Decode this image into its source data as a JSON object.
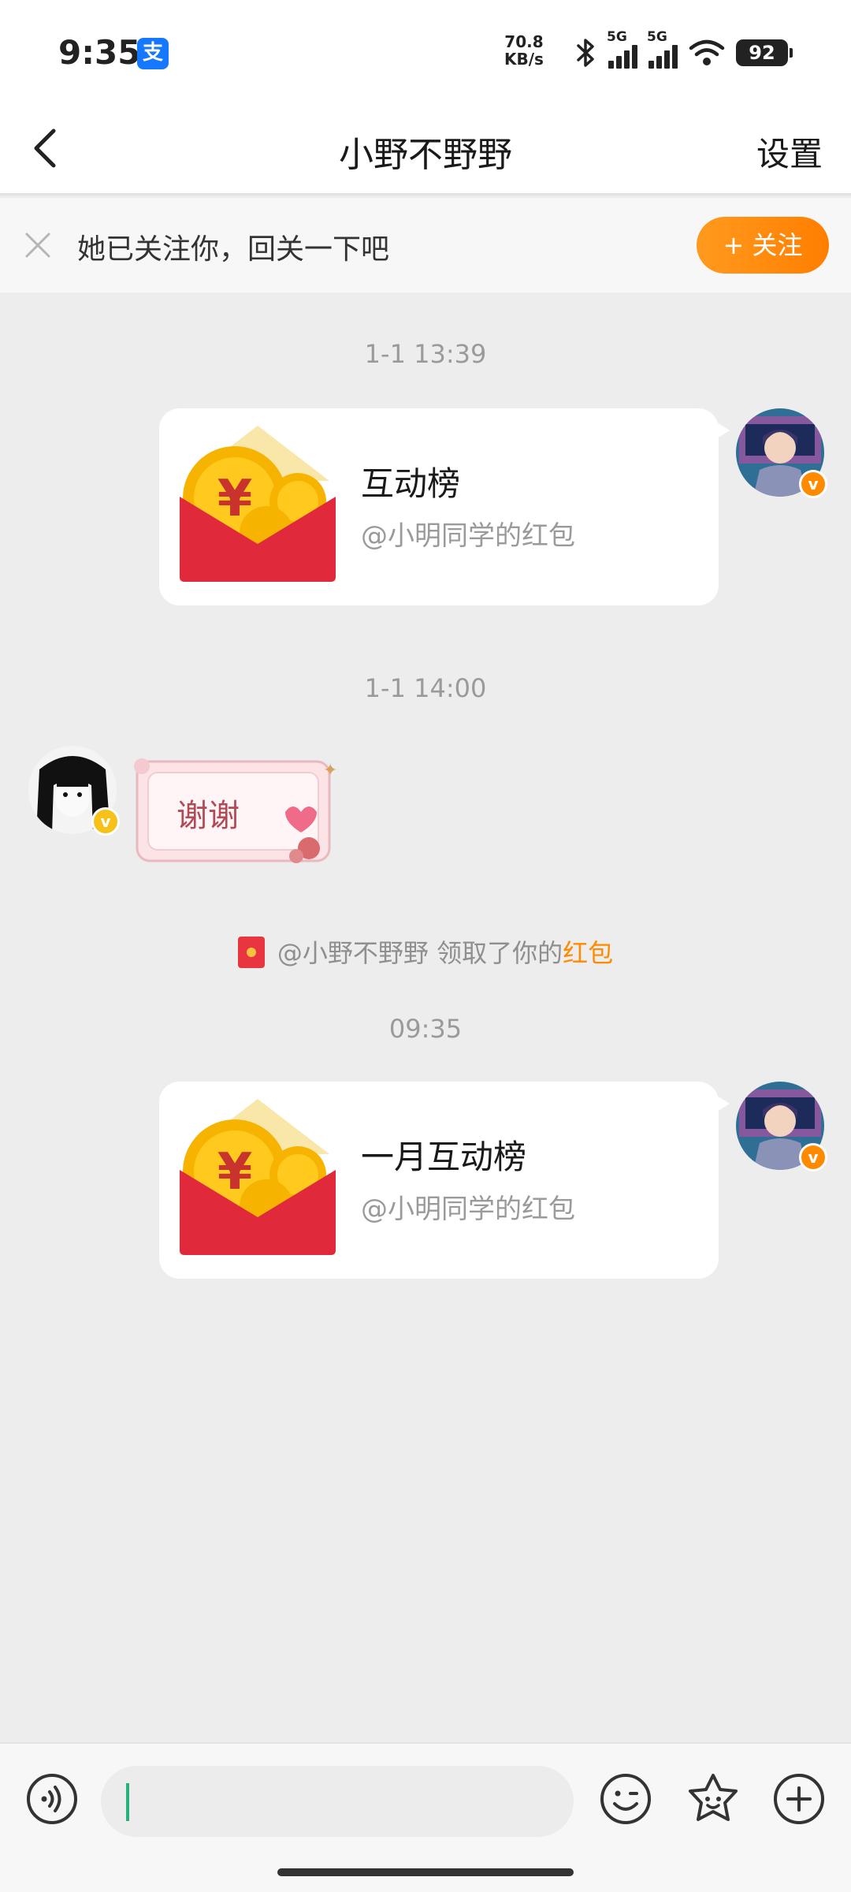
{
  "status_bar": {
    "time": "9:35",
    "alipay_glyph": "支",
    "speed_value": "70.8",
    "speed_unit": "KB/s",
    "sim1_label": "5G",
    "sim2_label": "5G",
    "battery": "92",
    "icons": [
      "alipay-icon",
      "bluetooth-icon",
      "signal-icon",
      "signal-icon",
      "wifi-icon",
      "battery-icon"
    ]
  },
  "header": {
    "title": "小野不野野",
    "settings_label": "设置",
    "back_icon": "chevron-left-icon"
  },
  "follow_bar": {
    "text": "她已关注你，回关一下吧",
    "button_label": "+ 关注",
    "close_icon": "close-icon"
  },
  "chat": {
    "timestamp_1": "1-1 13:39",
    "packet_1": {
      "title": "互动榜",
      "subtitle": "@小明同学的红包"
    },
    "timestamp_2": "1-1 14:00",
    "sticker_text": "谢谢",
    "system": {
      "prefix": "@小野不野野 领取了你的",
      "highlight": "红包"
    },
    "timestamp_3": "09:35",
    "packet_2": {
      "title": "一月互动榜",
      "subtitle": "@小明同学的红包"
    },
    "badge_glyph": "v"
  },
  "input_bar": {
    "placeholder": "",
    "icons": [
      "voice-icon",
      "emoji-icon",
      "sticker-icon",
      "plus-icon"
    ]
  },
  "colors": {
    "accent_orange": "#ff8a00",
    "red_packet": "#e02a3c",
    "coin_gold": "#f6b400",
    "caret_green": "#27b27a",
    "background": "#ededed"
  }
}
